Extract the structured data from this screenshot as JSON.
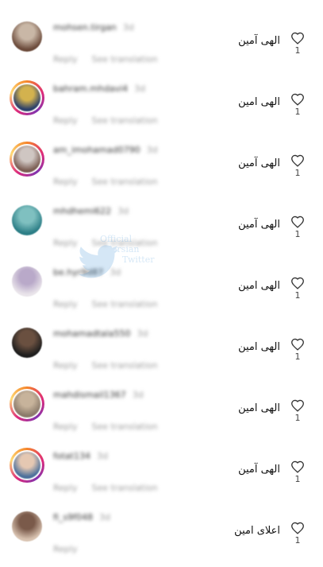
{
  "comments": [
    {
      "username": "mohsen.tirgan",
      "time": "3d",
      "reply": "Reply",
      "translate": "See translation",
      "text": "الهی آمین",
      "likes": "1",
      "story_ring": false,
      "avatar_colors": [
        "#6b4a3a",
        "#c9b7a6"
      ]
    },
    {
      "username": "bahram.mhdavi4",
      "time": "3d",
      "reply": "Reply",
      "translate": "See translation",
      "text": "الهی امین",
      "likes": "1",
      "story_ring": true,
      "avatar_colors": [
        "#2a3f6a",
        "#d3b24e"
      ]
    },
    {
      "username": "am_imohamad0790",
      "time": "3d",
      "reply": "Reply",
      "translate": "See translation",
      "text": "الهی آمین",
      "likes": "1",
      "story_ring": true,
      "avatar_colors": [
        "#7a5c52",
        "#cfc6c2"
      ]
    },
    {
      "username": "mhdhemi622",
      "time": "3d",
      "reply": "Reply",
      "translate": "See translation",
      "text": "الهی آمین",
      "likes": "1",
      "story_ring": false,
      "avatar_colors": [
        "#2c7e86",
        "#7fc0c0"
      ]
    },
    {
      "username": "be.hyr9d87",
      "time": "3d",
      "reply": "Reply",
      "translate": "See translation",
      "text": "الهی امین",
      "likes": "1",
      "story_ring": false,
      "avatar_colors": [
        "#e9e4ea",
        "#b9a9c9"
      ]
    },
    {
      "username": "mohamadtala550",
      "time": "3d",
      "reply": "Reply",
      "translate": "See translation",
      "text": "الهی امین",
      "likes": "1",
      "story_ring": false,
      "avatar_colors": [
        "#1d1d1d",
        "#6a5040"
      ]
    },
    {
      "username": "mahdismail1367",
      "time": "3d",
      "reply": "Reply",
      "translate": "See translation",
      "text": "الهی امین",
      "likes": "1",
      "story_ring": true,
      "avatar_colors": [
        "#8a7a6a",
        "#c7b39b"
      ]
    },
    {
      "username": "fotat134",
      "time": "3d",
      "reply": "Reply",
      "translate": "See translation",
      "text": "الهی آمین",
      "likes": "1",
      "story_ring": true,
      "avatar_colors": [
        "#4a6f9b",
        "#e5c8b2"
      ]
    },
    {
      "username": "fi_s9f048",
      "time": "3d",
      "reply": "Reply",
      "translate": "",
      "text": "اعلای امین",
      "likes": "1",
      "story_ring": false,
      "avatar_colors": [
        "#d8c2b0",
        "#7a5a4a"
      ]
    }
  ],
  "watermark": {
    "line1": "Official",
    "line2": "Persian",
    "line3": "Twitter"
  }
}
